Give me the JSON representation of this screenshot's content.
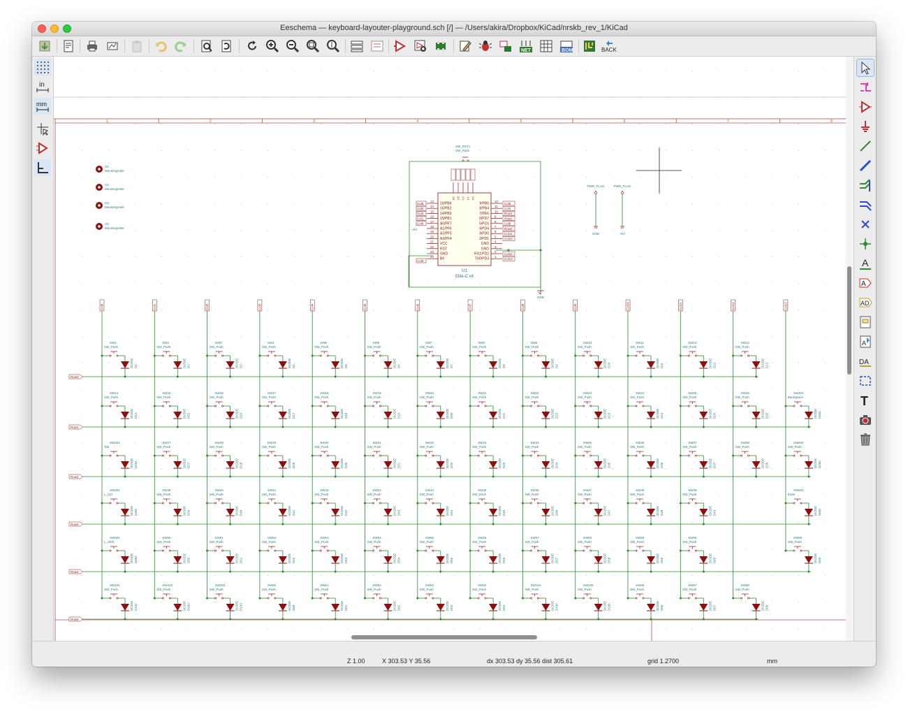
{
  "window": {
    "title": "Eeschema — keyboard-layouter-playground.sch [/] — /Users/akira/Dropbox/KiCad/nrskb_rev_1/KiCad"
  },
  "toolbar": {
    "back_label": "BACK",
    "net_label": "NET",
    "bom_label": "BOM",
    "pcb_label": "PCB"
  },
  "left_toolbar": {
    "inch_label": "in",
    "mm_label": "mm"
  },
  "status": {
    "zoom": "Z 1.00",
    "xy": "X 303.53  Y 35.56",
    "delta": "dx 303.53  dy 35.56  dist 305.61",
    "grid": "grid 1.2700",
    "units": "mm"
  },
  "colors": {
    "wire": "#2e8a2e",
    "label": "#8b1c1c",
    "diode": "#8b1010",
    "text": "#2a7a7a",
    "border": "#b84848"
  },
  "schematic": {
    "border_numbers": [
      "1",
      "2",
      "3",
      "4",
      "5",
      "6",
      "7",
      "8"
    ],
    "mounting_holes": [
      {
        "ref": "H1",
        "value": "MountingHole"
      },
      {
        "ref": "H2",
        "value": "MountingHole"
      },
      {
        "ref": "H3",
        "value": "MountingHole"
      },
      {
        "ref": "H4",
        "value": "MountingHole"
      }
    ],
    "reset_switch": {
      "ref": "SW_RST1",
      "value": "SW_Push"
    },
    "mcu": {
      "ref": "U1",
      "value": "Elite-C v4",
      "left_pins": [
        "10/PB6",
        "16/PB2",
        "14/PB3",
        "15/PB1",
        "A0/PF7",
        "A1/PF6",
        "A2/PF5",
        "A3/PF4",
        "VCC",
        "RST",
        "GND",
        "B0"
      ],
      "left_nums": [
        "13",
        "14",
        "15",
        "16",
        "17",
        "18",
        "19",
        "20",
        "21",
        "22",
        "23",
        "24"
      ],
      "right_pins": [
        "9/PB5",
        "8/PB4",
        "7/PE6",
        "6/PD7",
        "5/PC6",
        "4/PD4",
        "3/PD0",
        "2/PD1",
        "GND",
        "GND",
        "RX1/PD2",
        "TX0/PD3"
      ],
      "right_nums": [
        "12",
        "11",
        "10",
        "9",
        "8",
        "7",
        "6",
        "5",
        "4",
        "3",
        "2",
        "1"
      ],
      "top_pins": [
        "B7",
        "D5",
        "C7",
        "F1",
        "F0"
      ],
      "left_labels": [
        "Col6",
        "Col2",
        "Col3",
        "Col1",
        "Col0"
      ],
      "right_labels": [
        "Col5",
        "Col4",
        "Row1",
        "Row2",
        "Col8",
        "Row0",
        "Col11",
        "Col10",
        "Col12",
        "Col13"
      ],
      "vcc_label": "+5V",
      "gnd_label": "GND"
    },
    "power_flags": [
      {
        "name": "PWR_FLAG",
        "net": "GND"
      },
      {
        "name": "PWR_FLAG",
        "net": "+5V"
      }
    ],
    "column_labels": [
      "Col0",
      "Col1",
      "Col2",
      "Col3",
      "Col4",
      "Col5",
      "Col6",
      "Col7",
      "Col8",
      "Col9",
      "Col10",
      "Col11",
      "Col12",
      "Col13"
    ],
    "row_labels": [
      "Row0",
      "Row1",
      "Row2",
      "Row3",
      "Row4",
      "Row5"
    ],
    "switch_value": "SW_Push",
    "diode_value": "DIODE",
    "matrix": [
      [
        {
          "sw": "SW1",
          "d": "D1"
        },
        {
          "sw": "SW2",
          "d": "D2"
        },
        {
          "sw": "SW3",
          "d": "D3"
        },
        {
          "sw": "SW4",
          "d": "D4"
        },
        {
          "sw": "SW5",
          "d": "D5"
        },
        {
          "sw": "SW6",
          "d": "D6"
        },
        {
          "sw": "SW7",
          "d": "D7"
        },
        {
          "sw": "SW8",
          "d": "D8"
        },
        {
          "sw": "SW9",
          "d": "D9"
        },
        {
          "sw": "SW10",
          "d": "D10"
        },
        {
          "sw": "SW11",
          "d": "D11"
        },
        {
          "sw": "SW12",
          "d": "D12"
        },
        {
          "sw": "SW13",
          "d": "D13"
        },
        null
      ],
      [
        {
          "sw": "SW14",
          "d": "D14"
        },
        {
          "sw": "SW15",
          "d": "D15"
        },
        {
          "sw": "SW16",
          "d": "D16"
        },
        {
          "sw": "SW17",
          "d": "D17"
        },
        {
          "sw": "SW18",
          "d": "D18"
        },
        {
          "sw": "SW19",
          "d": "D19"
        },
        {
          "sw": "SW20",
          "d": "D20"
        },
        {
          "sw": "SW21",
          "d": "D21"
        },
        {
          "sw": "SW22",
          "d": "D22"
        },
        {
          "sw": "SW23",
          "d": "D23"
        },
        {
          "sw": "SW24",
          "d": "D24"
        },
        {
          "sw": "SW25",
          "d": "D25"
        },
        {
          "sw": "SW26",
          "d": "D26"
        },
        {
          "sw": "SW401",
          "d": "D401",
          "val": "Backspace"
        }
      ],
      [
        {
          "sw": "SW201",
          "d": "D201",
          "val": "Tab"
        },
        {
          "sw": "SW27",
          "d": "D27"
        },
        {
          "sw": "SW28",
          "d": "D28"
        },
        {
          "sw": "SW29",
          "d": "D29"
        },
        {
          "sw": "SW30",
          "d": "D30"
        },
        {
          "sw": "SW31",
          "d": "D31"
        },
        {
          "sw": "SW32",
          "d": "D32"
        },
        {
          "sw": "SW33",
          "d": "D33"
        },
        {
          "sw": "SW34",
          "d": "D34"
        },
        {
          "sw": "SW35",
          "d": "D35"
        },
        {
          "sw": "SW36",
          "d": "D36"
        },
        {
          "sw": "SW37",
          "d": "D37"
        },
        {
          "sw": "SW38",
          "d": "D38"
        },
        {
          "sw": "SW202",
          "d": "D202"
        }
      ],
      [
        {
          "sw": "SW301",
          "d": "D301",
          "val": "L_Ctrl"
        },
        {
          "sw": "SW39",
          "d": "D39"
        },
        {
          "sw": "SW40",
          "d": "D40"
        },
        {
          "sw": "SW41",
          "d": "D41"
        },
        {
          "sw": "SW42",
          "d": "D42"
        },
        {
          "sw": "SW43",
          "d": "D43"
        },
        {
          "sw": "SW44",
          "d": "D44"
        },
        {
          "sw": "SW45",
          "d": "D45"
        },
        {
          "sw": "SW46",
          "d": "D46"
        },
        {
          "sw": "SW47",
          "d": "D47"
        },
        {
          "sw": "SW48",
          "d": "D48"
        },
        {
          "sw": "SW49",
          "d": "D49"
        },
        null,
        {
          "sw": "SW601",
          "d": "D601",
          "val": "Enter"
        }
      ],
      [
        {
          "sw": "SW602",
          "d": "D602",
          "val": "L_Shift"
        },
        {
          "sw": "SW50",
          "d": "D50"
        },
        {
          "sw": "SW51",
          "d": "D51"
        },
        {
          "sw": "SW52",
          "d": "D52"
        },
        {
          "sw": "SW53",
          "d": "D53"
        },
        {
          "sw": "SW54",
          "d": "D54"
        },
        {
          "sw": "SW55",
          "d": "D55"
        },
        {
          "sw": "SW56",
          "d": "D56"
        },
        {
          "sw": "SW57",
          "d": "D57"
        },
        {
          "sw": "SW58",
          "d": "D58"
        },
        {
          "sw": "SW59",
          "d": "D59"
        },
        {
          "sw": "SW65",
          "d": "D65"
        },
        null,
        {
          "sw": "SW69",
          "d": "D69"
        }
      ],
      [
        {
          "sw": "SW101",
          "d": "D101"
        },
        {
          "sw": "SW102",
          "d": "D102"
        },
        {
          "sw": "SW103",
          "d": "D103"
        },
        {
          "sw": "SW60",
          "d": "D60"
        },
        {
          "sw": "SW61",
          "d": "D61"
        },
        {
          "sw": "SW62",
          "d": "D62"
        },
        {
          "sw": "SW63",
          "d": "D63"
        },
        {
          "sw": "SW64",
          "d": "D64"
        },
        {
          "sw": "SW104",
          "d": "D104"
        },
        {
          "sw": "SW105",
          "d": "D105"
        },
        {
          "sw": "SW66",
          "d": "D66"
        },
        {
          "sw": "SW67",
          "d": "D67"
        },
        {
          "sw": "SW68",
          "d": "D68"
        },
        null
      ]
    ]
  }
}
